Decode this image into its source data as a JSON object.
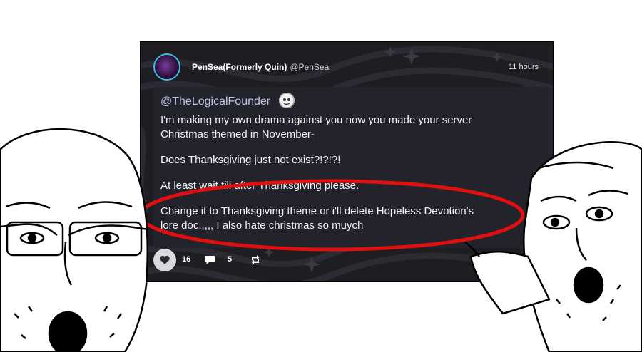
{
  "post": {
    "author_name": "PenSea(Formerly Quin)",
    "author_handle": "@PenSea",
    "timestamp": "11 hours",
    "mention": "@TheLogicalFounder",
    "paragraphs": [
      "I'm making my own drama against you now you made your server",
      "Christmas themed in November-",
      "Does Thanksgiving just not exist?!?!?!",
      "At least wait till after Thanksgiving please.",
      "Change it to Thanksgiving theme or i'll delete Hopeless Devotion's",
      "lore doc.,,,, I also hate christmas so muych"
    ]
  },
  "actions": {
    "likes": "16",
    "comments": "5"
  },
  "colors": {
    "card_bg": "#1d1d22",
    "post_bg": "#23232b",
    "highlight_circle": "#e01010"
  },
  "icons": [
    "heart-icon",
    "comment-icon",
    "reblog-icon",
    "more-icon",
    "sparkle-icon"
  ]
}
